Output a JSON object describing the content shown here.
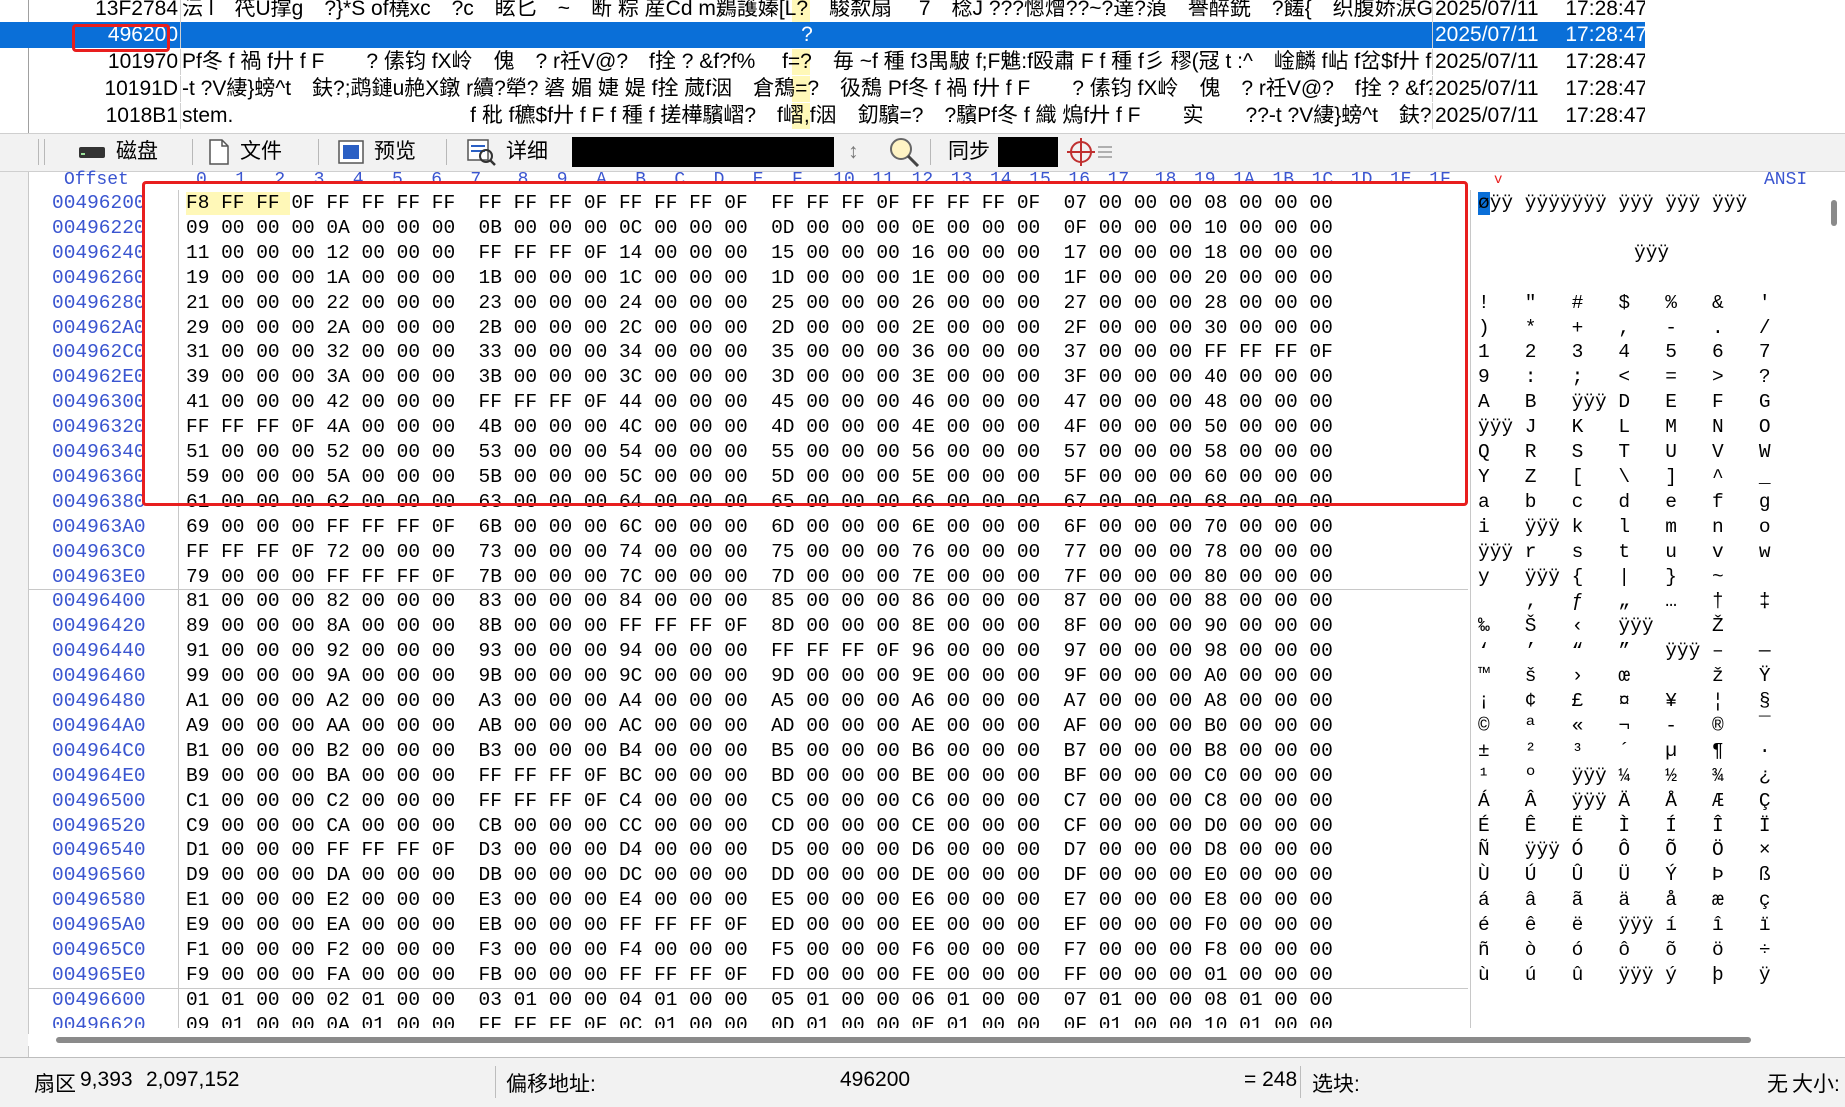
{
  "list": {
    "rows": [
      {
        "id": "13F2784",
        "text": "沄 l　笩U撑g　?}*S of橈xc　?c　眩匕　~　断 粽 産Cd m鶢護嫀[L?　駿歀扇　 7　稔J ???憁熷??~?達?蒗　譽醉銑　?饈{　织腹娇涙G悅 }",
        "date": "2025/07/11　 17:28:47"
      },
      {
        "id": "496200",
        "text": "?",
        "date": "2025/07/11　 17:28:47"
      },
      {
        "id": "101970",
        "text": "Pf冬 f 禍 f廾 f F　　? 傃钧 fX岭　傀　? r祍V@?　f拴 ? &f?f%　 f=?　毎 ~f 種 f3禺駊 f;F魋:f殴肅 F f 種 f彡 穋(冦 t :^　崯麟 f岾 f岔$f廾 f 罫",
        "date": "2025/07/11　 17:28:47"
      },
      {
        "id": "10191D",
        "text": "-t ?V緀}螃^t　鈇?;鹉鏈u赩X鐓 r續?犖? 碆 媚 婕 媞 f拴 蒇f洇　倉鵚=?　彶鵚 Pf冬 f 禍 f廾 f F　　? 傃钧 fX岭　傀　? r祍V@?　f拴 ? &f?f%",
        "date": "2025/07/11　 17:28:47"
      },
      {
        "id": "1018B1",
        "text": "stem.　　　　　　　　　　　 f 秕 f穮$f廾 f F f 種 f 搓樺驞嶍?　f嶍,f洇　釖驞=?　?驞Pf冬 f 織 熓f廾 f F　　实　　??-t ?V緀}螃^t　鈇?;鹉鏈u赩X鐓 r續",
        "date": "2025/07/11　 17:28:47"
      }
    ]
  },
  "toolbar": {
    "disk": "磁盘",
    "file": "文件",
    "preview": "预览",
    "detail": "详细",
    "sync": "同步",
    "updown_glyph": "↕"
  },
  "hex_header": {
    "offset": "Offset",
    "cols": [
      "0",
      "1",
      "2",
      "3",
      "4",
      "5",
      "6",
      "7",
      "8",
      "9",
      "A",
      "B",
      "C",
      "D",
      "E",
      "F",
      "10",
      "11",
      "12",
      "13",
      "14",
      "15",
      "16",
      "17",
      "18",
      "19",
      "1A",
      "1B",
      "1C",
      "1D",
      "1E",
      "1F"
    ],
    "chevron": "v",
    "ansi": "ANSI"
  },
  "hex": {
    "rows": [
      {
        "off": "00496200",
        "bytes": "F8 FF FF 0F FF FF FF FF  FF FF FF 0F FF FF FF 0F  FF FF FF 0F FF FF FF 0F  07 00 00 00 08 00 00 00",
        "ascii": "øÿÿ ÿÿÿÿÿÿÿ ÿÿÿ ÿÿÿ ÿÿÿ"
      },
      {
        "off": "00496220",
        "bytes": "09 00 00 00 0A 00 00 00  0B 00 00 00 0C 00 00 00  0D 00 00 00 0E 00 00 00  0F 00 00 00 10 00 00 00",
        "ascii": ""
      },
      {
        "off": "00496240",
        "bytes": "11 00 00 00 12 00 00 00  FF FF FF 0F 14 00 00 00  15 00 00 00 16 00 00 00  17 00 00 00 18 00 00 00",
        "ascii": "　　　　　　　　ÿÿÿ"
      },
      {
        "off": "00496260",
        "bytes": "19 00 00 00 1A 00 00 00  1B 00 00 00 1C 00 00 00  1D 00 00 00 1E 00 00 00  1F 00 00 00 20 00 00 00",
        "ascii": ""
      },
      {
        "off": "00496280",
        "bytes": "21 00 00 00 22 00 00 00  23 00 00 00 24 00 00 00  25 00 00 00 26 00 00 00  27 00 00 00 28 00 00 00",
        "ascii": "!   \"   #   $   %   &   '"
      },
      {
        "off": "004962A0",
        "bytes": "29 00 00 00 2A 00 00 00  2B 00 00 00 2C 00 00 00  2D 00 00 00 2E 00 00 00  2F 00 00 00 30 00 00 00",
        "ascii": ")   *   +   ,   -   .   /"
      },
      {
        "off": "004962C0",
        "bytes": "31 00 00 00 32 00 00 00  33 00 00 00 34 00 00 00  35 00 00 00 36 00 00 00  37 00 00 00 FF FF FF 0F",
        "ascii": "1   2   3   4   5   6   7"
      },
      {
        "off": "004962E0",
        "bytes": "39 00 00 00 3A 00 00 00  3B 00 00 00 3C 00 00 00  3D 00 00 00 3E 00 00 00  3F 00 00 00 40 00 00 00",
        "ascii": "9   :   ;   <   =   >   ?"
      },
      {
        "off": "00496300",
        "bytes": "41 00 00 00 42 00 00 00  FF FF FF 0F 44 00 00 00  45 00 00 00 46 00 00 00  47 00 00 00 48 00 00 00",
        "ascii": "A   B   ÿÿÿ D   E   F   G"
      },
      {
        "off": "00496320",
        "bytes": "FF FF FF 0F 4A 00 00 00  4B 00 00 00 4C 00 00 00  4D 00 00 00 4E 00 00 00  4F 00 00 00 50 00 00 00",
        "ascii": "ÿÿÿ J   K   L   M   N   O"
      },
      {
        "off": "00496340",
        "bytes": "51 00 00 00 52 00 00 00  53 00 00 00 54 00 00 00  55 00 00 00 56 00 00 00  57 00 00 00 58 00 00 00",
        "ascii": "Q   R   S   T   U   V   W"
      },
      {
        "off": "00496360",
        "bytes": "59 00 00 00 5A 00 00 00  5B 00 00 00 5C 00 00 00  5D 00 00 00 5E 00 00 00  5F 00 00 00 60 00 00 00",
        "ascii": "Y   Z   [   \\   ]   ^   _"
      },
      {
        "off": "00496380",
        "bytes": "61 00 00 00 62 00 00 00  63 00 00 00 64 00 00 00  65 00 00 00 66 00 00 00  67 00 00 00 68 00 00 00",
        "ascii": "a   b   c   d   e   f   g"
      },
      {
        "off": "004963A0",
        "bytes": "69 00 00 00 FF FF FF 0F  6B 00 00 00 6C 00 00 00  6D 00 00 00 6E 00 00 00  6F 00 00 00 70 00 00 00",
        "ascii": "i   ÿÿÿ k   l   m   n   o"
      },
      {
        "off": "004963C0",
        "bytes": "FF FF FF 0F 72 00 00 00  73 00 00 00 74 00 00 00  75 00 00 00 76 00 00 00  77 00 00 00 78 00 00 00",
        "ascii": "ÿÿÿ r   s   t   u   v   w"
      },
      {
        "off": "004963E0",
        "bytes": "79 00 00 00 FF FF FF 0F  7B 00 00 00 7C 00 00 00  7D 00 00 00 7E 00 00 00  7F 00 00 00 80 00 00 00",
        "ascii": "y   ÿÿÿ {   |   }   ~"
      },
      {
        "off": "00496400",
        "bytes": "81 00 00 00 82 00 00 00  83 00 00 00 84 00 00 00  85 00 00 00 86 00 00 00  87 00 00 00 88 00 00 00",
        "ascii": "    ‚   ƒ   „   …   †   ‡"
      },
      {
        "off": "00496420",
        "bytes": "89 00 00 00 8A 00 00 00  8B 00 00 00 FF FF FF 0F  8D 00 00 00 8E 00 00 00  8F 00 00 00 90 00 00 00",
        "ascii": "‰   Š   ‹   ÿÿÿ     Ž"
      },
      {
        "off": "00496440",
        "bytes": "91 00 00 00 92 00 00 00  93 00 00 00 94 00 00 00  FF FF FF 0F 96 00 00 00  97 00 00 00 98 00 00 00",
        "ascii": "‘   ’   “   ”   ÿÿÿ –   —"
      },
      {
        "off": "00496460",
        "bytes": "99 00 00 00 9A 00 00 00  9B 00 00 00 9C 00 00 00  9D 00 00 00 9E 00 00 00  9F 00 00 00 A0 00 00 00",
        "ascii": "™   š   ›   œ       ž   Ÿ"
      },
      {
        "off": "00496480",
        "bytes": "A1 00 00 00 A2 00 00 00  A3 00 00 00 A4 00 00 00  A5 00 00 00 A6 00 00 00  A7 00 00 00 A8 00 00 00",
        "ascii": "¡   ¢   £   ¤   ¥   ¦   §"
      },
      {
        "off": "004964A0",
        "bytes": "A9 00 00 00 AA 00 00 00  AB 00 00 00 AC 00 00 00  AD 00 00 00 AE 00 00 00  AF 00 00 00 B0 00 00 00",
        "ascii": "©   ª   «   ¬   -   ®   ¯"
      },
      {
        "off": "004964C0",
        "bytes": "B1 00 00 00 B2 00 00 00  B3 00 00 00 B4 00 00 00  B5 00 00 00 B6 00 00 00  B7 00 00 00 B8 00 00 00",
        "ascii": "±   ²   ³   ´   µ   ¶   ·"
      },
      {
        "off": "004964E0",
        "bytes": "B9 00 00 00 BA 00 00 00  FF FF FF 0F BC 00 00 00  BD 00 00 00 BE 00 00 00  BF 00 00 00 C0 00 00 00",
        "ascii": "¹   º   ÿÿÿ ¼   ½   ¾   ¿"
      },
      {
        "off": "00496500",
        "bytes": "C1 00 00 00 C2 00 00 00  FF FF FF 0F C4 00 00 00  C5 00 00 00 C6 00 00 00  C7 00 00 00 C8 00 00 00",
        "ascii": "Á   Â   ÿÿÿ Ä   Å   Æ   Ç"
      },
      {
        "off": "00496520",
        "bytes": "C9 00 00 00 CA 00 00 00  CB 00 00 00 CC 00 00 00  CD 00 00 00 CE 00 00 00  CF 00 00 00 D0 00 00 00",
        "ascii": "É   Ê   Ë   Ì   Í   Î   Ï"
      },
      {
        "off": "00496540",
        "bytes": "D1 00 00 00 FF FF FF 0F  D3 00 00 00 D4 00 00 00  D5 00 00 00 D6 00 00 00  D7 00 00 00 D8 00 00 00",
        "ascii": "Ñ   ÿÿÿ Ó   Ô   Õ   Ö   ×"
      },
      {
        "off": "00496560",
        "bytes": "D9 00 00 00 DA 00 00 00  DB 00 00 00 DC 00 00 00  DD 00 00 00 DE 00 00 00  DF 00 00 00 E0 00 00 00",
        "ascii": "Ù   Ú   Û   Ü   Ý   Þ   ß"
      },
      {
        "off": "00496580",
        "bytes": "E1 00 00 00 E2 00 00 00  E3 00 00 00 E4 00 00 00  E5 00 00 00 E6 00 00 00  E7 00 00 00 E8 00 00 00",
        "ascii": "á   â   ã   ä   å   æ   ç"
      },
      {
        "off": "004965A0",
        "bytes": "E9 00 00 00 EA 00 00 00  EB 00 00 00 FF FF FF 0F  ED 00 00 00 EE 00 00 00  EF 00 00 00 F0 00 00 00",
        "ascii": "é   ê   ë   ÿÿÿ í   î   ï"
      },
      {
        "off": "004965C0",
        "bytes": "F1 00 00 00 F2 00 00 00  F3 00 00 00 F4 00 00 00  F5 00 00 00 F6 00 00 00  F7 00 00 00 F8 00 00 00",
        "ascii": "ñ   ò   ó   ô   õ   ö   ÷"
      },
      {
        "off": "004965E0",
        "bytes": "F9 00 00 00 FA 00 00 00  FB 00 00 00 FF FF FF 0F  FD 00 00 00 FE 00 00 00  FF 00 00 00 01 00 00 00",
        "ascii": "ù   ú   û   ÿÿÿ ý   þ   ÿ"
      },
      {
        "off": "00496600",
        "bytes": "01 01 00 00 02 01 00 00  03 01 00 00 04 01 00 00  05 01 00 00 06 01 00 00  07 01 00 00 08 01 00 00",
        "ascii": ""
      },
      {
        "off": "00496620",
        "bytes": "09 01 00 00 0A 01 00 00  FF FF FF 0F 0C 01 00 00  0D 01 00 00 0E 01 00 00  0F 01 00 00 10 01 00 00",
        "ascii": "　　　　　　　　　　　　　　　　　　　　　　　　　ÿÿÿ"
      }
    ]
  },
  "status": {
    "sector_label": "扇区",
    "sector_value": "9,393",
    "sector_total": "2,097,152",
    "offset_label": "偏移地址:",
    "offset_value": "496200",
    "equals": "= 248",
    "selection_label": "选块:",
    "selection_value": "无",
    "size_label": "大小:"
  },
  "colors": {
    "selected_row": "#0a6fd8",
    "highlight": "#fff8b8",
    "annotation_red": "#e81e1e",
    "offset_blue": "#3a55d0"
  }
}
